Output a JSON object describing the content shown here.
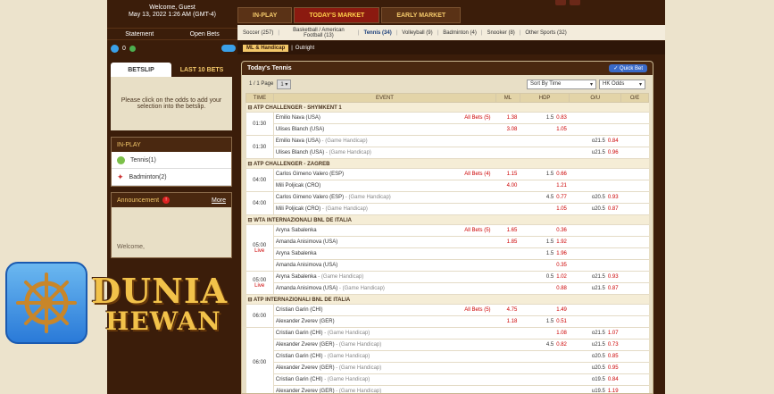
{
  "header": {
    "welcome": "Welcome, Guest",
    "datetime": "May 13, 2022 1:26 AM (GMT-4)",
    "statement": "Statement",
    "open_bets": "Open Bets",
    "balance": "0"
  },
  "top_tabs": [
    "IN-PLAY",
    "TODAY'S MARKET",
    "EARLY MARKET"
  ],
  "sports": [
    "Soccer (257)",
    "Basketball / American Football (13)",
    "Tennis (34)",
    "Volleyball (9)",
    "Badminton (4)",
    "Snooker (8)",
    "Other Sports (32)"
  ],
  "sub_tabs": [
    "ML & Handicap",
    "Outright"
  ],
  "betslip": {
    "tab_betslip": "BETSLIP",
    "tab_last": "LAST 10 BETS",
    "message": "Please click on the odds to add your selection into the betslip."
  },
  "inplay": {
    "title": "IN-PLAY",
    "items": [
      "Tennis(1)",
      "Badminton(2)"
    ]
  },
  "announcement": {
    "title": "Announcement",
    "more": "More",
    "body": "Welcome,"
  },
  "panel": {
    "title": "Today's Tennis",
    "quick_bet": "Quick Bet",
    "page": "1 / 1 Page",
    "page_select": "1",
    "sort": "Sort By Time",
    "odds": "HK Odds"
  },
  "columns": [
    "TIME",
    "EVENT",
    "ML",
    "HDP",
    "O/U",
    "O/E"
  ],
  "leagues": [
    {
      "name": "ATP CHALLENGER - SHYMKENT 1",
      "matches": [
        {
          "time": "01:30",
          "live": "",
          "all": "All Bets (5)",
          "rows": [
            {
              "team": "Emilio Nava (USA)",
              "tag": "",
              "ml": "1.38",
              "hl": "1.5",
              "hv": "0.83",
              "ol": "",
              "ov": ""
            },
            {
              "team": "Ulises Blanch (USA)",
              "tag": "",
              "ml": "3.08",
              "hl": "",
              "hv": "1.05",
              "ol": "",
              "ov": ""
            }
          ]
        },
        {
          "time": "01:30",
          "live": "",
          "all": "",
          "rows": [
            {
              "team": "Emilio Nava (USA)",
              "tag": " - (Game Handicap)",
              "ml": "",
              "hl": "",
              "hv": "",
              "ol": "o21.5",
              "ov": "0.84"
            },
            {
              "team": "Ulises Blanch (USA)",
              "tag": " - (Game Handicap)",
              "ml": "",
              "hl": "",
              "hv": "",
              "ol": "u21.5",
              "ov": "0.96"
            }
          ]
        }
      ]
    },
    {
      "name": "ATP CHALLENGER - ZAGREB",
      "matches": [
        {
          "time": "04:00",
          "live": "",
          "all": "All Bets (4)",
          "rows": [
            {
              "team": "Carlos Gimeno Valero (ESP)",
              "tag": "",
              "ml": "1.15",
              "hl": "1.5",
              "hv": "0.66",
              "ol": "",
              "ov": ""
            },
            {
              "team": "Mili Poljicak (CRO)",
              "tag": "",
              "ml": "4.00",
              "hl": "",
              "hv": "1.21",
              "ol": "",
              "ov": ""
            }
          ]
        },
        {
          "time": "04:00",
          "live": "",
          "all": "",
          "rows": [
            {
              "team": "Carlos Gimeno Valero (ESP)",
              "tag": " - (Game Handicap)",
              "ml": "",
              "hl": "4.5",
              "hv": "0.77",
              "ol": "o20.5",
              "ov": "0.93"
            },
            {
              "team": "Mili Poljicak (CRO)",
              "tag": " - (Game Handicap)",
              "ml": "",
              "hl": "",
              "hv": "1.05",
              "ol": "u20.5",
              "ov": "0.87"
            }
          ]
        }
      ]
    },
    {
      "name": "WTA INTERNAZIONALI BNL DE ITALIA",
      "matches": [
        {
          "time": "05:00",
          "live": "Live",
          "all": "All Bets (5)",
          "rows": [
            {
              "team": "Aryna Sabalenka",
              "tag": "",
              "ml": "1.65",
              "hl": "",
              "hv": "0.36",
              "ol": "",
              "ov": ""
            },
            {
              "team": "Amanda Anisimova (USA)",
              "tag": "",
              "ml": "1.85",
              "hl": "1.5",
              "hv": "1.92",
              "ol": "",
              "ov": ""
            },
            {
              "team": "Aryna Sabalenka",
              "tag": "",
              "ml": "",
              "hl": "1.5",
              "hv": "1.96",
              "ol": "",
              "ov": ""
            },
            {
              "team": "Amanda Anisimova (USA)",
              "tag": "",
              "ml": "",
              "hl": "",
              "hv": "0.35",
              "ol": "",
              "ov": ""
            }
          ]
        },
        {
          "time": "05:00",
          "live": "Live",
          "all": "",
          "rows": [
            {
              "team": "Aryna Sabalenka",
              "tag": " - (Game Handicap)",
              "ml": "",
              "hl": "0.5",
              "hv": "1.02",
              "ol": "o21.5",
              "ov": "0.93"
            },
            {
              "team": "Amanda Anisimova (USA)",
              "tag": " - (Game Handicap)",
              "ml": "",
              "hl": "",
              "hv": "0.88",
              "ol": "u21.5",
              "ov": "0.87"
            }
          ]
        }
      ]
    },
    {
      "name": "ATP INTERNAZIONALI BNL DE ITALIA",
      "matches": [
        {
          "time": "06:00",
          "live": "",
          "all": "All Bets (5)",
          "rows": [
            {
              "team": "Cristian Garin (CHI)",
              "tag": "",
              "ml": "4.75",
              "hl": "",
              "hv": "1.49",
              "ol": "",
              "ov": ""
            },
            {
              "team": "Alexander Zverev (GER)",
              "tag": "",
              "ml": "1.18",
              "hl": "1.5",
              "hv": "0.51",
              "ol": "",
              "ov": ""
            }
          ]
        },
        {
          "time": "06:00",
          "live": "",
          "all": "",
          "rows": [
            {
              "team": "Cristian Garin (CHI)",
              "tag": " - (Game Handicap)",
              "ml": "",
              "hl": "",
              "hv": "1.08",
              "ol": "o21.5",
              "ov": "1.07"
            },
            {
              "team": "Alexander Zverev (GER)",
              "tag": " - (Game Handicap)",
              "ml": "",
              "hl": "4.5",
              "hv": "0.82",
              "ol": "u21.5",
              "ov": "0.73"
            },
            {
              "team": "Cristian Garin (CHI)",
              "tag": " - (Game Handicap)",
              "ml": "",
              "hl": "",
              "hv": "",
              "ol": "o20.5",
              "ov": "0.85"
            },
            {
              "team": "Alexander Zverev (GER)",
              "tag": " - (Game Handicap)",
              "ml": "",
              "hl": "",
              "hv": "",
              "ol": "u20.5",
              "ov": "0.95"
            },
            {
              "team": "Cristian Garin (CHI)",
              "tag": " - (Game Handicap)",
              "ml": "",
              "hl": "",
              "hv": "",
              "ol": "o19.5",
              "ov": "0.84"
            },
            {
              "team": "Alexander Zverev (GER)",
              "tag": " - (Game Handicap)",
              "ml": "",
              "hl": "",
              "hv": "",
              "ol": "u19.5",
              "ov": "1.19"
            }
          ]
        }
      ]
    }
  ],
  "logo": {
    "line1": "DUNIA",
    "line2": "HEWAN",
    "icon": "ship-wheel-icon"
  },
  "colors": {
    "accent": "#8b1a10",
    "brand_gold": "#f2c24a",
    "odds_red": "#cc0000"
  }
}
